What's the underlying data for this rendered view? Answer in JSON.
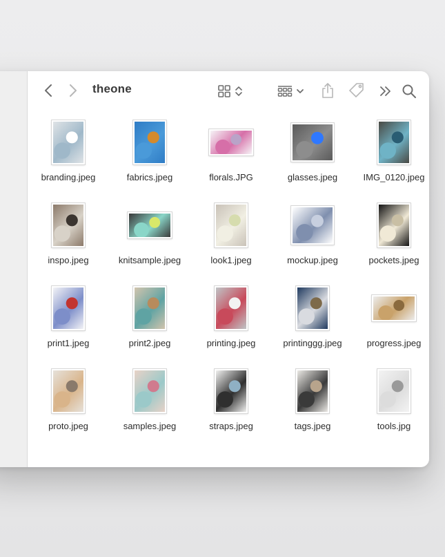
{
  "window": {
    "title": "theone"
  },
  "icons": {
    "back": "chevron-left-icon",
    "forward": "chevron-right-icon",
    "view": "icon-grid-view-icon",
    "group": "group-by-icon",
    "share": "share-icon",
    "tag": "tag-icon",
    "more": "double-chevron-right-icon",
    "search": "magnifying-glass-icon"
  },
  "colors": {
    "window_bg": "#ffffff",
    "sidebar_bg": "#efefef",
    "toolbar_icon": "#6e6e6e",
    "toolbar_icon_disabled": "#b7b7b7",
    "label_text": "#2c2c2c"
  },
  "files": [
    {
      "name": "branding.jpeg",
      "orientation": "portrait",
      "palette": [
        "#dfe3e6",
        "#9fb8c9",
        "#ffffff"
      ]
    },
    {
      "name": "fabrics.jpeg",
      "orientation": "portrait",
      "palette": [
        "#2f7cc5",
        "#4a9ad9",
        "#d48a2c"
      ]
    },
    {
      "name": "florals.JPG",
      "orientation": "landscape",
      "palette": [
        "#f6f4f7",
        "#d66fa8",
        "#b9a3c8"
      ]
    },
    {
      "name": "glasses.jpeg",
      "orientation": "square",
      "palette": [
        "#5b5b5b",
        "#8d8d8d",
        "#2f78ff"
      ]
    },
    {
      "name": "IMG_0120.jpeg",
      "orientation": "portrait",
      "palette": [
        "#4a4a44",
        "#6fb3c6",
        "#2a5d73"
      ]
    },
    {
      "name": "inspo.jpeg",
      "orientation": "portrait",
      "palette": [
        "#8c7a6a",
        "#d8d2c8",
        "#3b3530"
      ]
    },
    {
      "name": "knitsample.jpeg",
      "orientation": "landscape",
      "palette": [
        "#3a3a3a",
        "#8ad6c8",
        "#d9e86a"
      ]
    },
    {
      "name": "look1.jpeg",
      "orientation": "portrait",
      "palette": [
        "#c9c2b8",
        "#f1efe3",
        "#d6dcae"
      ]
    },
    {
      "name": "mockup.jpeg",
      "orientation": "square",
      "palette": [
        "#ffffff",
        "#7f8fae",
        "#c7cfdf"
      ]
    },
    {
      "name": "pockets.jpeg",
      "orientation": "portrait",
      "palette": [
        "#141414",
        "#f0e9d6",
        "#c9bfa4"
      ]
    },
    {
      "name": "print1.jpeg",
      "orientation": "portrait",
      "palette": [
        "#f3f3f6",
        "#7d8ec9",
        "#c2342f"
      ]
    },
    {
      "name": "print2.jpeg",
      "orientation": "portrait",
      "palette": [
        "#d2c4ad",
        "#5fa3a3",
        "#b78b5d"
      ]
    },
    {
      "name": "printing.jpeg",
      "orientation": "portrait",
      "palette": [
        "#bfc4c6",
        "#c84a5b",
        "#f2f2f2"
      ]
    },
    {
      "name": "printinggg.jpeg",
      "orientation": "portrait",
      "palette": [
        "#203a5f",
        "#d9dbe0",
        "#7d6a4a"
      ]
    },
    {
      "name": "progress.jpeg",
      "orientation": "landscape",
      "palette": [
        "#ececec",
        "#c9a26a",
        "#8a6a3e"
      ]
    },
    {
      "name": "proto.jpeg",
      "orientation": "portrait",
      "palette": [
        "#e6e1da",
        "#d9b48a",
        "#8a7a6b"
      ]
    },
    {
      "name": "samples.jpeg",
      "orientation": "portrait",
      "palette": [
        "#e8d2c7",
        "#9bc9c9",
        "#d07b8e"
      ]
    },
    {
      "name": "straps.jpeg",
      "orientation": "portrait",
      "palette": [
        "#f0f0ef",
        "#2f2f2f",
        "#8fb0c4"
      ]
    },
    {
      "name": "tags.jpeg",
      "orientation": "portrait",
      "palette": [
        "#ebe9e5",
        "#3a3a3a",
        "#b8a48c"
      ]
    },
    {
      "name": "tools.jpg",
      "orientation": "portrait",
      "palette": [
        "#f3f3f3",
        "#dcdcdc",
        "#9a9a9a"
      ]
    }
  ]
}
